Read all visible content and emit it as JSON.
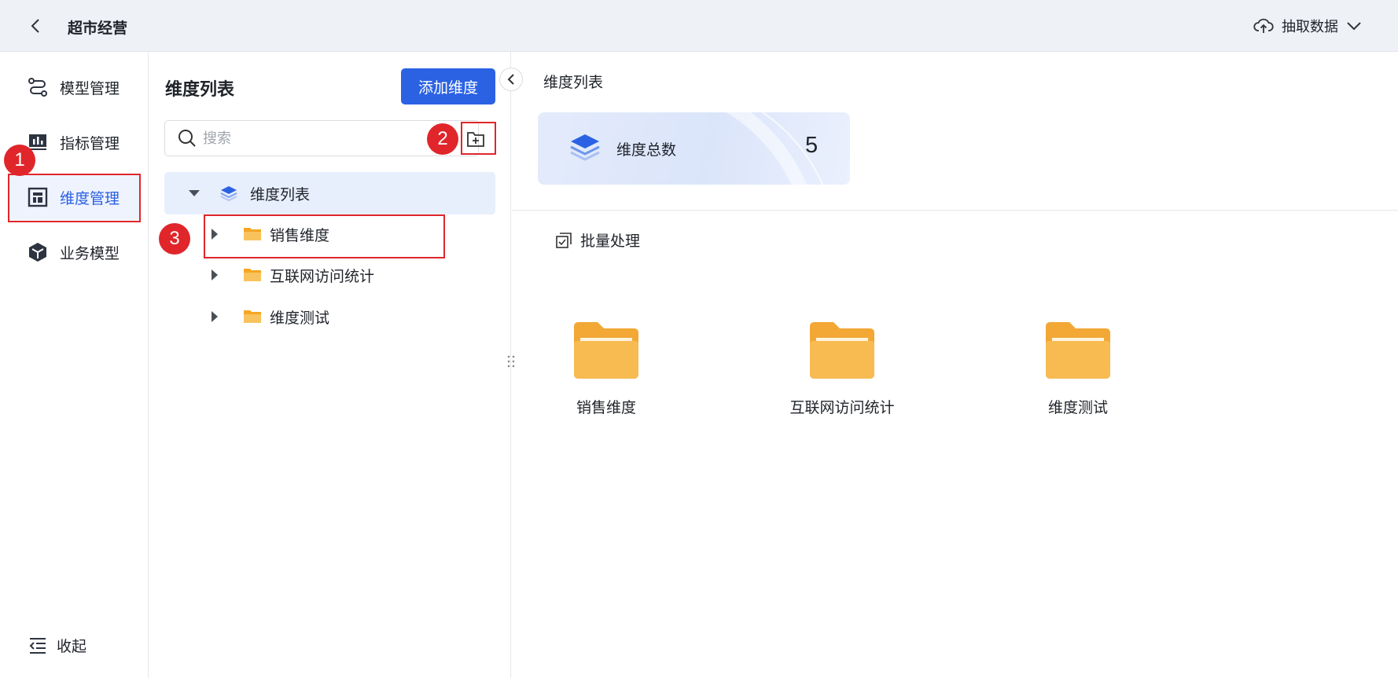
{
  "header": {
    "title": "超市经营",
    "extract_label": "抽取数据"
  },
  "leftnav": {
    "items": [
      {
        "label": "模型管理",
        "icon": "model-icon"
      },
      {
        "label": "指标管理",
        "icon": "chart-icon"
      },
      {
        "label": "维度管理",
        "icon": "dimension-icon",
        "active": true
      },
      {
        "label": "业务模型",
        "icon": "cube-icon"
      }
    ],
    "collapse_label": "收起"
  },
  "midpanel": {
    "title": "维度列表",
    "add_button": "添加维度",
    "search_placeholder": "搜索",
    "tree": {
      "root": "维度列表",
      "children": [
        "销售维度",
        "互联网访问统计",
        "维度测试"
      ]
    }
  },
  "rightpanel": {
    "breadcrumb": "维度列表",
    "stat": {
      "label": "维度总数",
      "value": "5"
    },
    "batch_label": "批量处理",
    "folders": [
      "销售维度",
      "互联网访问统计",
      "维度测试"
    ]
  },
  "annotations": [
    "1",
    "2",
    "3"
  ],
  "colors": {
    "accent": "#2b62e3",
    "annotation": "#e0262b",
    "folder": "#f5b13d"
  }
}
